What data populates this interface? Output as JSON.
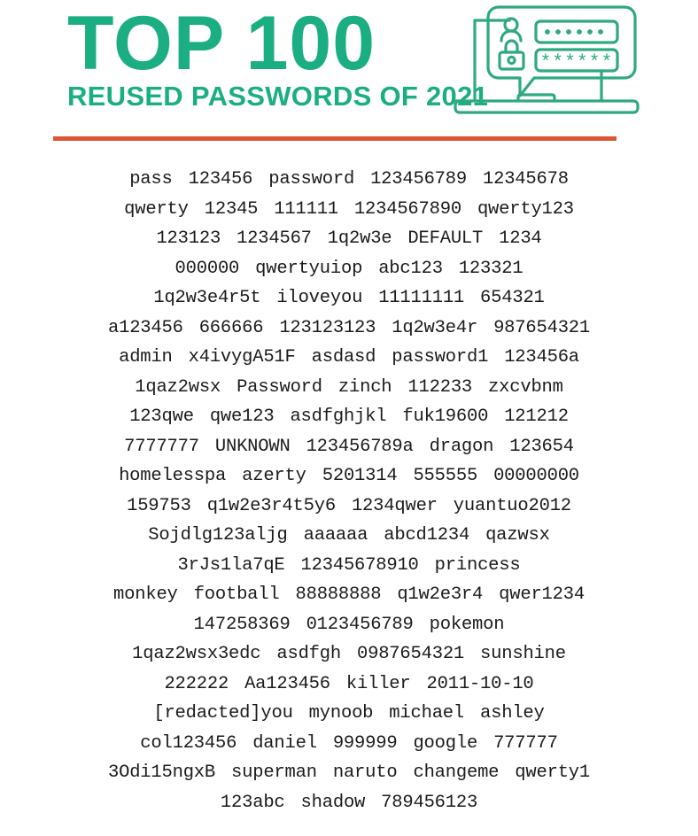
{
  "header": {
    "title_main": "TOP 100",
    "title_sub": "REUSED PASSWORDS OF 2021",
    "accent_green": "#1BAE82",
    "divider_color": "#DC5535"
  },
  "hero_icon": {
    "name": "laptop-login-bubble-icon",
    "stroke_color": "#2FA97E",
    "username_field_value": "••••••",
    "password_field_value": "******",
    "user_icon": "user-icon",
    "lock_icon": "lock-icon"
  },
  "password_list": {
    "rows": [
      [
        "pass",
        "123456",
        "password",
        "123456789",
        "12345678"
      ],
      [
        "qwerty",
        "12345",
        "111111",
        "1234567890",
        "qwerty123"
      ],
      [
        "123123",
        "1234567",
        "1q2w3e",
        "DEFAULT",
        "1234"
      ],
      [
        "000000",
        "qwertyuiop",
        "abc123",
        "123321"
      ],
      [
        "1q2w3e4r5t",
        "iloveyou",
        "11111111",
        "654321"
      ],
      [
        "a123456",
        "666666",
        "123123123",
        "1q2w3e4r",
        "987654321"
      ],
      [
        "admin",
        "x4ivygA51F",
        "asdasd",
        "password1",
        "123456a"
      ],
      [
        "1qaz2wsx",
        "Password",
        "zinch",
        "112233",
        "zxcvbnm"
      ],
      [
        "123qwe",
        "qwe123",
        "asdfghjkl",
        "fuk19600",
        "121212"
      ],
      [
        "7777777",
        "UNKNOWN",
        "123456789a",
        "dragon",
        "123654"
      ],
      [
        "homelesspa",
        "azerty",
        "5201314",
        "555555",
        "00000000"
      ],
      [
        "159753",
        "q1w2e3r4t5y6",
        "1234qwer",
        "yuantuo2012"
      ],
      [
        "Sojdlg123aljg",
        "aaaaaa",
        "abcd1234",
        "qazwsx"
      ],
      [
        "3rJs1la7qE",
        "12345678910",
        "princess"
      ],
      [
        "monkey",
        "football",
        "88888888",
        "q1w2e3r4",
        "qwer1234"
      ],
      [
        "147258369",
        "0123456789",
        "pokemon"
      ],
      [
        "1qaz2wsx3edc",
        "asdfgh",
        "0987654321",
        "sunshine"
      ],
      [
        "222222",
        "Aa123456",
        "killer",
        "2011-10-10"
      ],
      [
        "[redacted]you",
        "mynoob",
        "michael",
        "ashley"
      ],
      [
        "col123456",
        "daniel",
        "999999",
        "google",
        "777777"
      ],
      [
        "3Odi15ngxB",
        "superman",
        "naruto",
        "changeme",
        "qwerty1"
      ],
      [
        "123abc",
        "shadow",
        "789456123"
      ]
    ]
  }
}
